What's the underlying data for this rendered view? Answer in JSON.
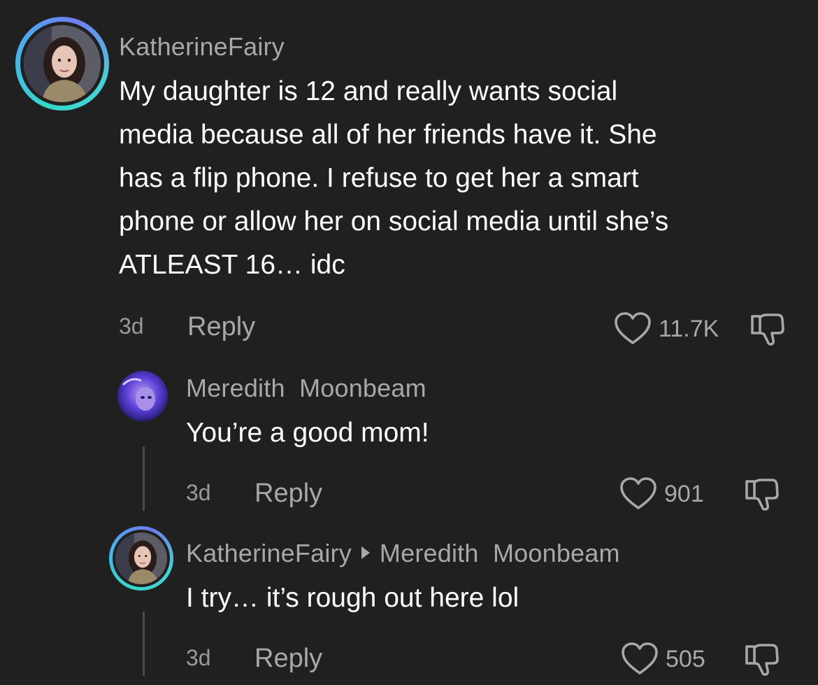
{
  "comments": [
    {
      "username": "KatherineFairy",
      "text": "My daughter is 12 and really wants social\nmedia because all of her friends have it. She\nhas a flip phone. I refuse to get her a smart\nphone or allow her on social media until she’s\nATLEAST 16… idc",
      "age": "3d",
      "reply_label": "Reply",
      "likes": "11.7K"
    },
    {
      "username": "Meredith  Moonbeam",
      "text": "You’re a good mom!",
      "age": "3d",
      "reply_label": "Reply",
      "likes": "901"
    },
    {
      "username": "KatherineFairy",
      "reply_to": "Meredith  Moonbeam",
      "text": "I try… it’s rough out here lol",
      "age": "3d",
      "reply_label": "Reply",
      "likes": "505"
    }
  ],
  "colors": {
    "background": "#202020",
    "text": "#ffffff",
    "muted": "#a8a8a8",
    "ring": "#36d7c8"
  },
  "icons": [
    "heart-icon",
    "dislike-icon",
    "triangle-right-icon"
  ]
}
